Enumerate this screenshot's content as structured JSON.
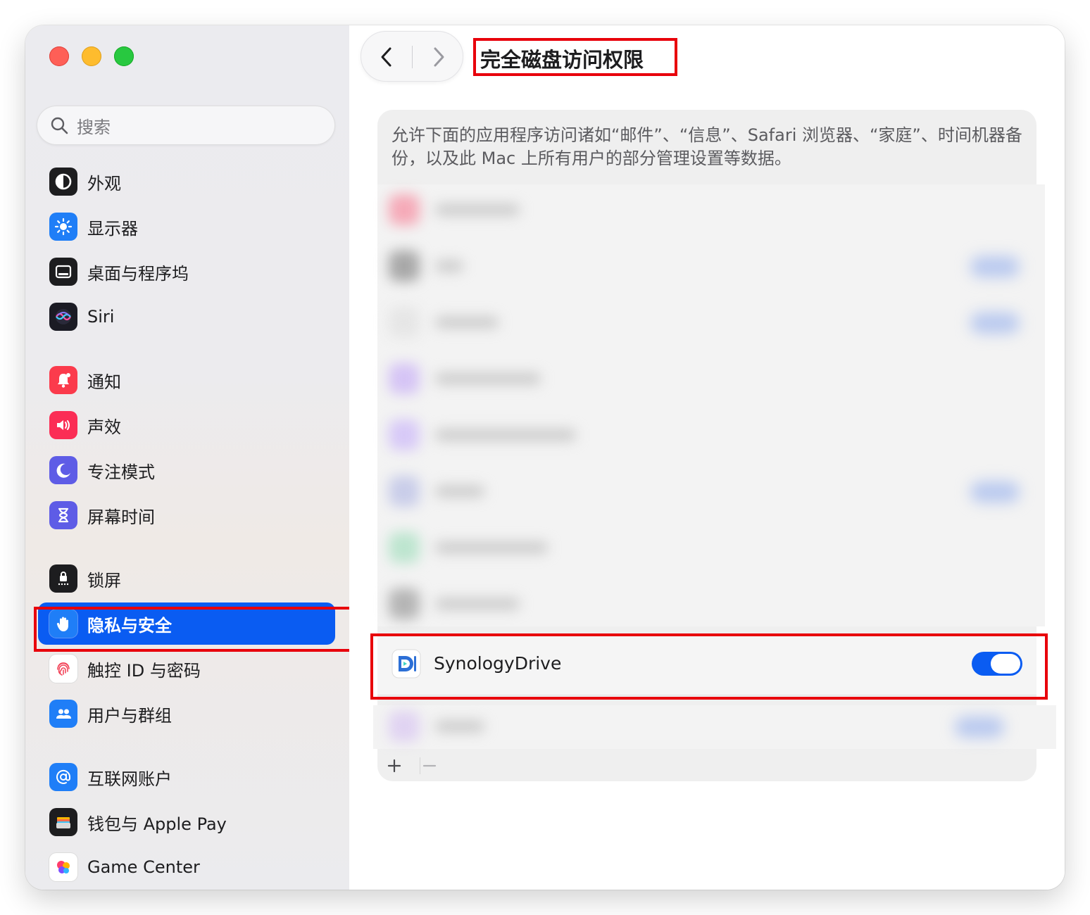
{
  "window": {
    "title": "完全磁盘访问权限"
  },
  "search": {
    "placeholder": "搜索"
  },
  "sidebar": {
    "items": [
      {
        "label": "外观",
        "icon": "appearance-icon",
        "color": "#1d1d1f"
      },
      {
        "label": "显示器",
        "icon": "display-sun-icon",
        "color": "#1f7ef7"
      },
      {
        "label": "桌面与程序坞",
        "icon": "desktop-dock-icon",
        "color": "#1d1d1f"
      },
      {
        "label": "Siri",
        "icon": "siri-icon",
        "color": "#2a2a35"
      },
      {
        "label": "通知",
        "icon": "notification-bell-icon",
        "color": "#fb3b4c"
      },
      {
        "label": "声效",
        "icon": "speaker-icon",
        "color": "#fb2d55"
      },
      {
        "label": "专注模式",
        "icon": "moon-icon",
        "color": "#5e5ce6"
      },
      {
        "label": "屏幕时间",
        "icon": "hourglass-icon",
        "color": "#5e5ce6"
      },
      {
        "label": "锁屏",
        "icon": "lock-screen-icon",
        "color": "#1d1d1f"
      },
      {
        "label": "隐私与安全",
        "icon": "hand-raised-icon",
        "color": "#1f7ef7",
        "selected": true
      },
      {
        "label": "触控 ID 与密码",
        "icon": "fingerprint-icon",
        "color": "#ffffff"
      },
      {
        "label": "用户与群组",
        "icon": "users-icon",
        "color": "#1f7ef7"
      },
      {
        "label": "互联网账户",
        "icon": "at-sign-icon",
        "color": "#1f7ef7"
      },
      {
        "label": "钱包与 Apple Pay",
        "icon": "wallet-icon",
        "color": "#1d1d1f"
      },
      {
        "label": "Game Center",
        "icon": "game-center-icon",
        "color": "#ffffff"
      }
    ]
  },
  "main": {
    "description": "允许下面的应用程序访问诸如“邮件”、“信息”、Safari 浏览器、“家庭”、时间机器备份，以及此 Mac 上所有用户的部分管理设置等数据。",
    "apps": [
      {
        "name": "SynologyDrive",
        "enabled": true
      }
    ]
  },
  "colors": {
    "accent": "#0a5cf2",
    "annotation": "#e8000b"
  }
}
